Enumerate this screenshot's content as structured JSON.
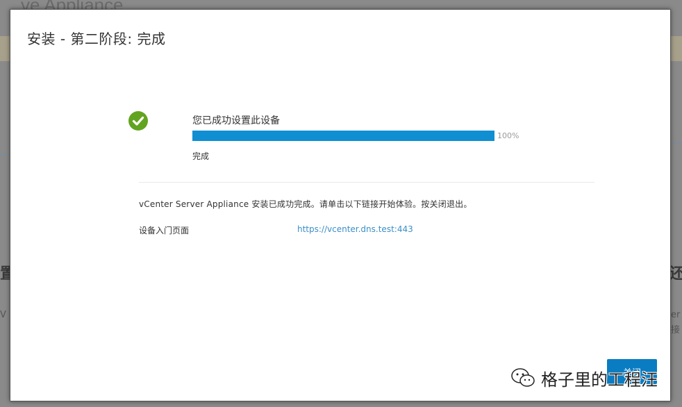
{
  "background": {
    "title_fragment": "ve Appliance",
    "left_fragments": [
      "置",
      "V"
    ],
    "right_fragments": [
      "还",
      "er",
      "接"
    ]
  },
  "dialog": {
    "title": "安装 - 第二阶段: 完成",
    "status_text": "您已成功设置此设备",
    "progress_percent": 100,
    "progress_label": "100%",
    "status_sub": "完成",
    "message": "vCenter Server Appliance 安装已成功完成。请单击以下链接开始体验。按关闭退出。",
    "portal_label": "设备入门页面",
    "portal_link": "https://vcenter.dns.test:443",
    "close_label": "关闭"
  },
  "watermark": {
    "text": "格子里的工程汪",
    "icon": "wechat-icon"
  },
  "colors": {
    "progress_fill": "#0f8fd2",
    "success": "#62a420",
    "link": "#3a8fc8",
    "button": "#0a7cc2"
  }
}
